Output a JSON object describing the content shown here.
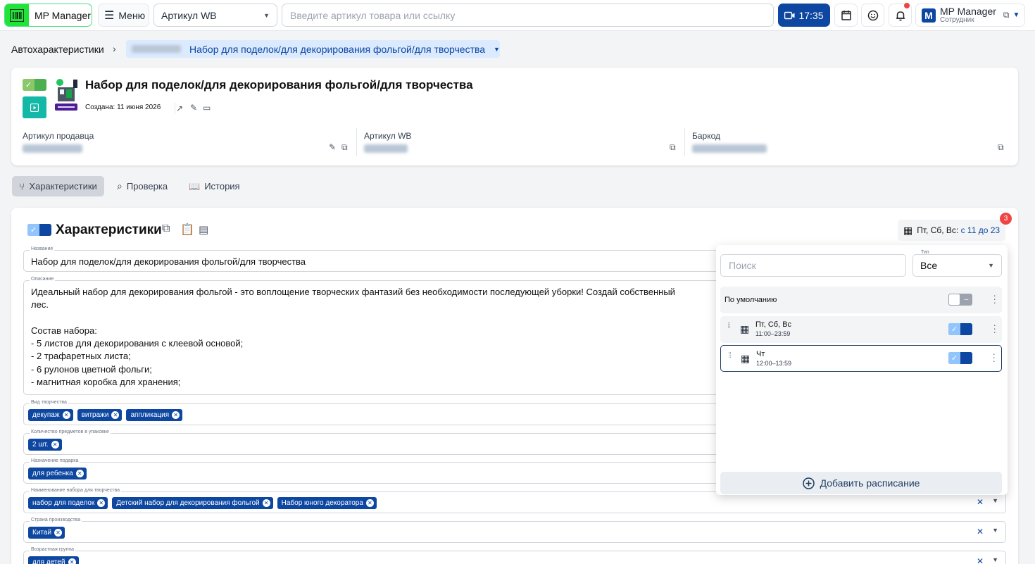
{
  "header": {
    "app_name": "MP Manager",
    "menu_label": "Меню",
    "search_type": "Артикул WB",
    "search_placeholder": "Введите артикул товара или ссылку",
    "time": "17:35",
    "user_initial": "M",
    "user_name": "MP Manager",
    "user_role": "Сотрудник"
  },
  "breadcrumb": {
    "root": "Автохарактеристики",
    "current": "Набор для поделок/для декорирования фольгой/для творчества"
  },
  "product": {
    "title": "Набор для поделок/для декорирования фольгой/для творчества",
    "created": "Создана: 11 июня 2026",
    "seller_article_label": "Артикул продавца",
    "wb_article_label": "Артикул WB",
    "barcode_label": "Баркод"
  },
  "tabs": [
    {
      "label": "Характеристики",
      "active": true
    },
    {
      "label": "Проверка",
      "active": false
    },
    {
      "label": "История",
      "active": false
    }
  ],
  "characteristics": {
    "title": "Характеристики",
    "schedule_prefix": "Пт, Сб, Вс: ",
    "schedule_range": "с 11 до 23",
    "schedule_count": "3",
    "fields": {
      "name_label": "Название",
      "name_value": "Набор для поделок/для декорирования фольгой/для творчества",
      "desc_label": "Описание",
      "desc_value": "Идеальный набор для декорирования фольгой - это воплощение творческих фантазий без необходимости последующей уборки! Создай собственный\nлес.\n\nСостав набора:\n- 5 листов для декорирования с клеевой основой;\n- 2 трафаретных листа;\n- 6 рулонов цветной фольги;\n- магнитная коробка для хранения;",
      "kind_label": "Вид творчества",
      "kind_chips": [
        "декупаж",
        "витражи",
        "аппликация"
      ],
      "qty_label": "Количество предметов в упаковке",
      "qty_chips": [
        "2 шт."
      ],
      "gift_label": "Назначение подарка",
      "gift_chips": [
        "для ребенка"
      ],
      "set_label": "Наименование набора для творчества",
      "set_chips": [
        "набор для поделок",
        "Детский набор для декорирования фольгой",
        "Набор юного декоратора"
      ],
      "country_label": "Страна производства",
      "country_chips": [
        "Китай"
      ],
      "age_label": "Возрастная группа",
      "age_chips": [
        "для детей"
      ]
    }
  },
  "schedule_panel": {
    "search_placeholder": "Поиск",
    "type_label": "Тип",
    "type_value": "Все",
    "default_label": "По умолчанию",
    "rows": [
      {
        "days": "Пт, Сб, Вс",
        "time": "11:00–23:59"
      },
      {
        "days": "Чт",
        "time": "12:00–13:59"
      }
    ],
    "add_label": "Добавить расписание"
  },
  "colors": {
    "brand": "#0d47a1",
    "logo_green": "#22e33a",
    "badge_red": "#ef4444"
  }
}
